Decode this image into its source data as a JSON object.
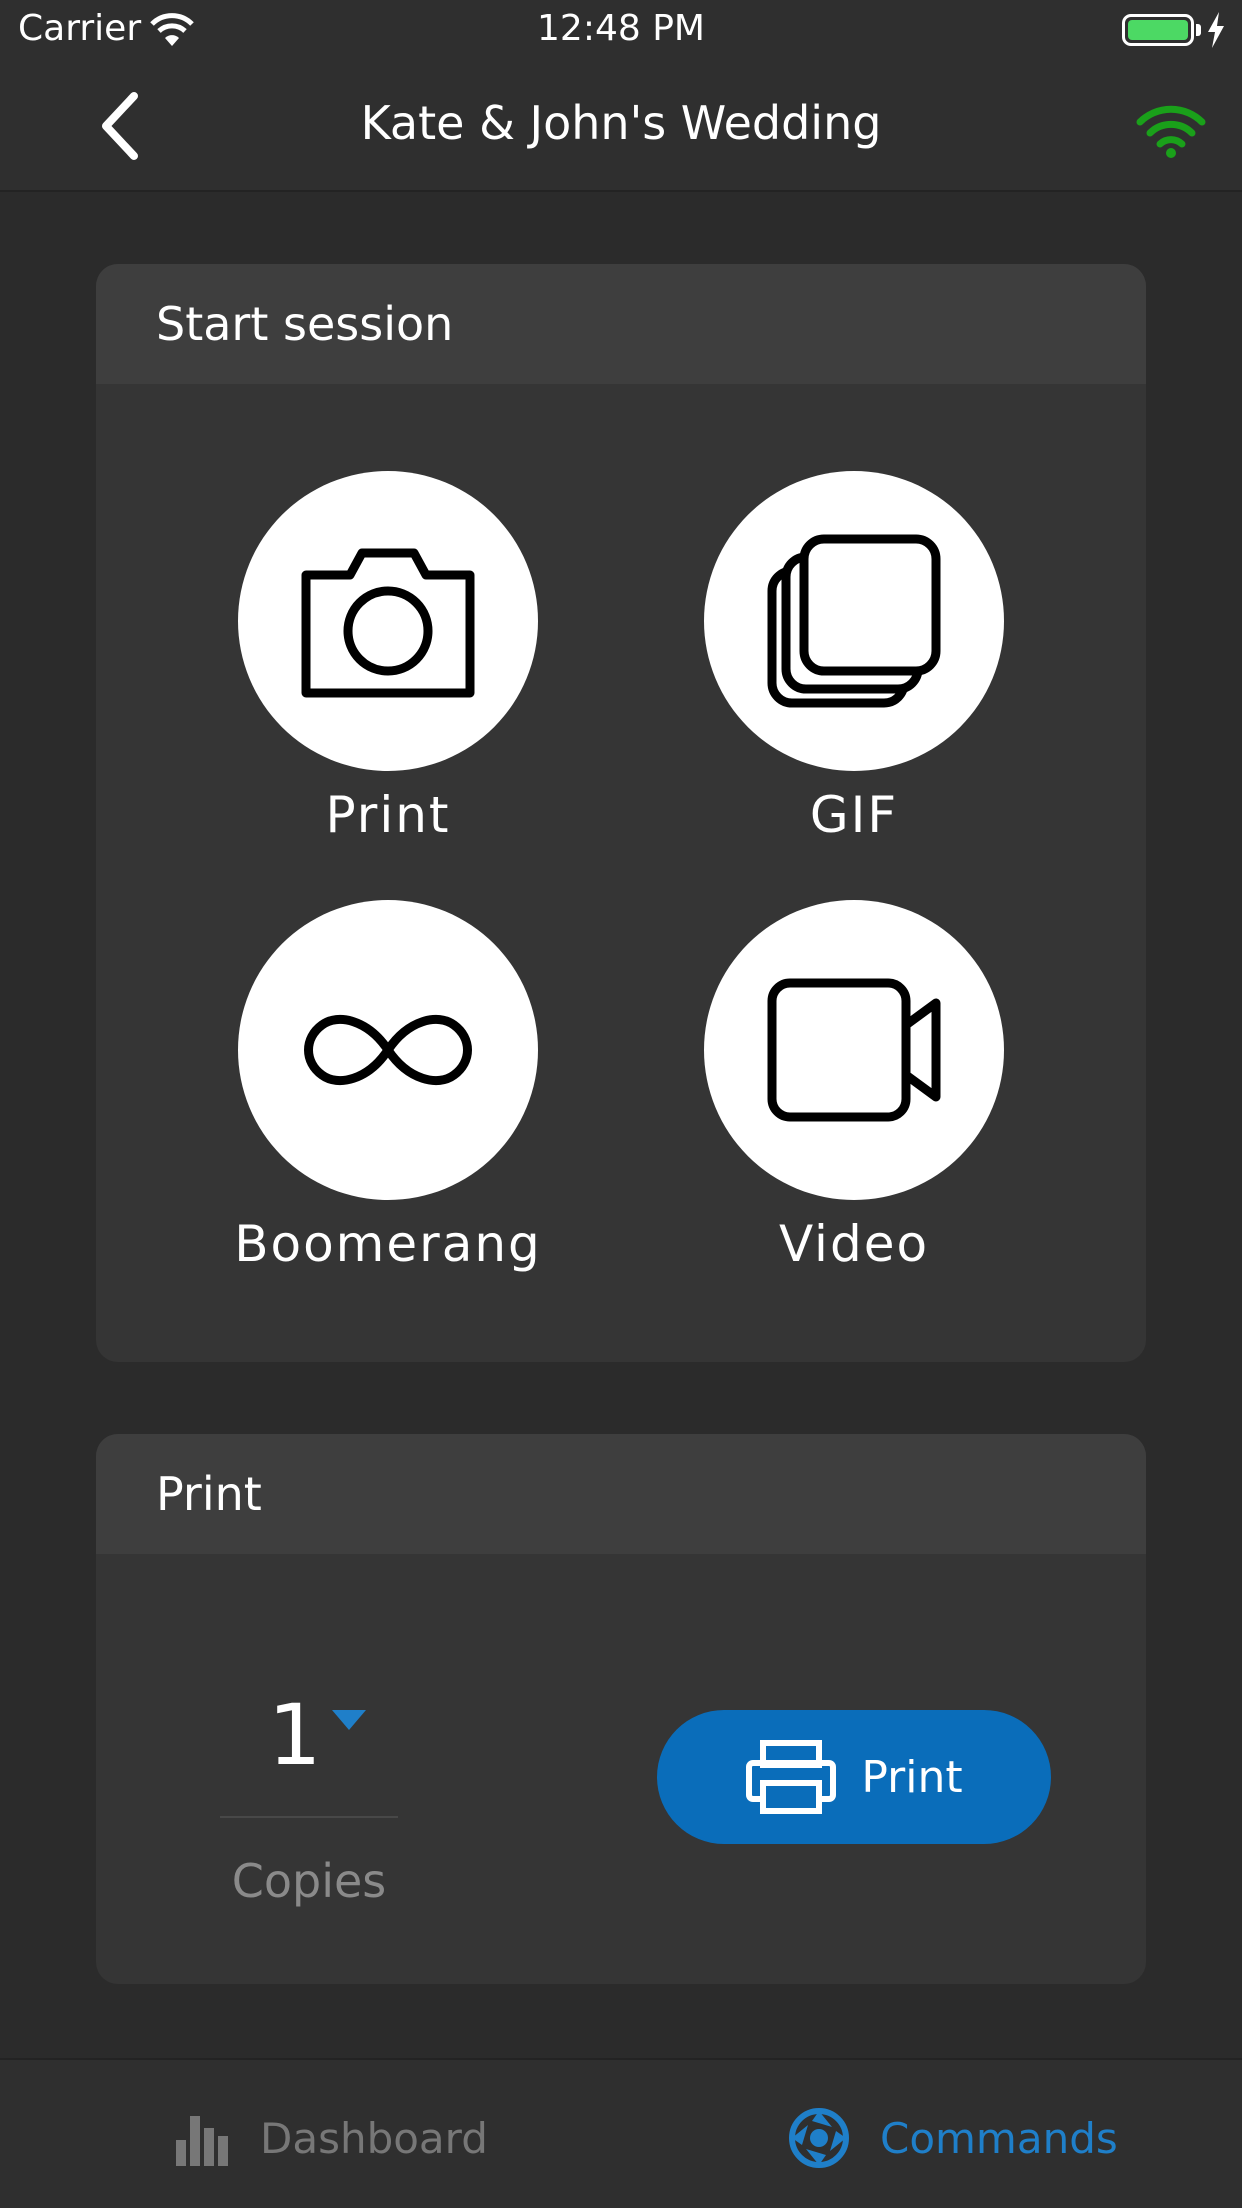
{
  "status_bar": {
    "carrier": "Carrier",
    "time": "12:48 PM",
    "battery_color": "#4cd964"
  },
  "nav": {
    "title": "Kate & John's Wedding",
    "back_icon": "chevron-left-icon",
    "connection_icon": "wifi-icon",
    "connection_color": "#1aa01a"
  },
  "session": {
    "header": "Start session",
    "modes": [
      {
        "label": "Print",
        "icon": "camera-icon"
      },
      {
        "label": "GIF",
        "icon": "stack-icon"
      },
      {
        "label": "Boomerang",
        "icon": "infinity-icon"
      },
      {
        "label": "Video",
        "icon": "video-camera-icon"
      }
    ]
  },
  "print": {
    "header": "Print",
    "copies_value": "1",
    "copies_label": "Copies",
    "button_label": "Print",
    "button_color": "#0a6dba"
  },
  "tabs": [
    {
      "label": "Dashboard",
      "icon": "bar-chart-icon",
      "active": false
    },
    {
      "label": "Commands",
      "icon": "aperture-icon",
      "active": true
    }
  ],
  "colors": {
    "background": "#2b2b2b",
    "card": "#353535",
    "card_header": "#3e3e3e",
    "accent": "#1f7fc9"
  }
}
